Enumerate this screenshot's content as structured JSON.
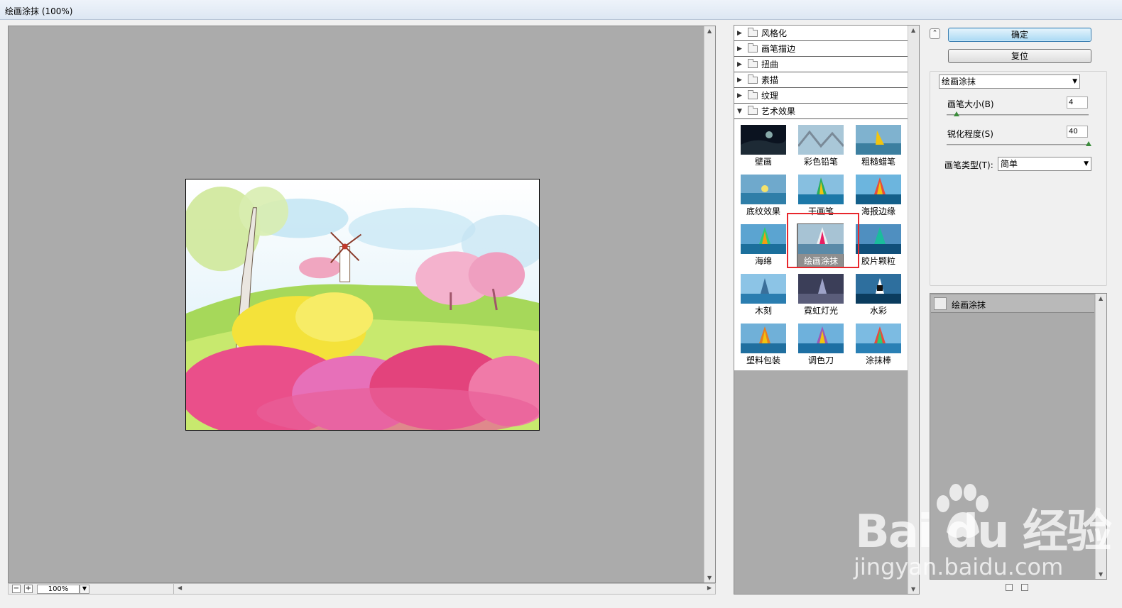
{
  "window": {
    "title": "绘画涂抹 (100%)"
  },
  "preview": {
    "zoom": "100%"
  },
  "filter_gallery": {
    "categories": [
      "风格化",
      "画笔描边",
      "扭曲",
      "素描",
      "纹理",
      "艺术效果"
    ],
    "thumbnails": [
      "壁画",
      "彩色铅笔",
      "粗糙蜡笔",
      "底纹效果",
      "干画笔",
      "海报边缘",
      "海绵",
      "绘画涂抹",
      "胶片颗粒",
      "木刻",
      "霓虹灯光",
      "水彩",
      "塑料包装",
      "调色刀",
      "涂抹棒"
    ],
    "selected": "绘画涂抹"
  },
  "buttons": {
    "ok": "确定",
    "reset": "复位"
  },
  "settings": {
    "filter_select": "绘画涂抹",
    "brush_size_label": "画笔大小(B)",
    "brush_size_value": "4",
    "brush_size_fraction": 0.07,
    "sharpness_label": "锐化程度(S)",
    "sharpness_value": "40",
    "sharpness_fraction": 1.0,
    "brush_type_label": "画笔类型(T):",
    "brush_type_value": "简单"
  },
  "layers": {
    "items": [
      "绘画涂抹"
    ]
  },
  "watermark": {
    "brand": "Bai du 经验",
    "url": "jingyan.baidu.com"
  },
  "colors": {
    "highlight": "#e8272c",
    "panel": "#ababab",
    "primary_button": "#a9d9f4"
  }
}
